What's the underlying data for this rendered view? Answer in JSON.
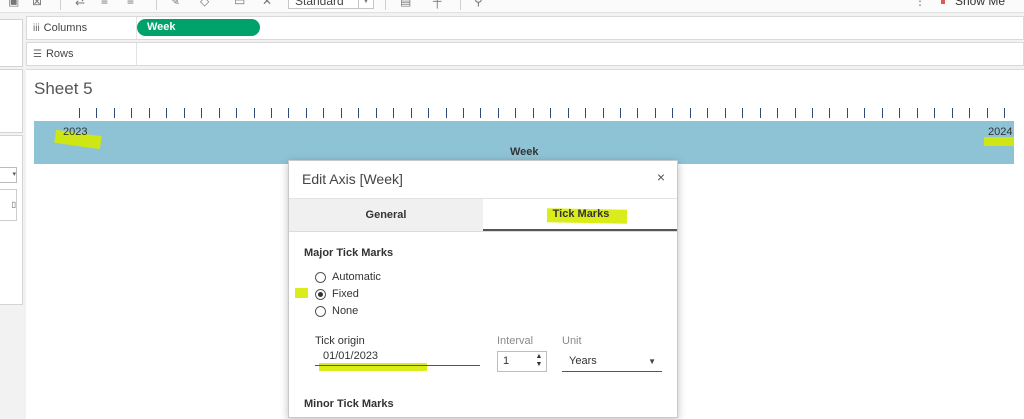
{
  "toolbar": {
    "zoom_select": "Standard",
    "show_me_label": "Show Me",
    "icons": [
      "clear-sheet-icon",
      "swap-icon",
      "sort-asc-icon",
      "sort-desc-icon",
      "highlight-icon",
      "group-icon",
      "label-icon",
      "pin-icon",
      "presentation-icon",
      "fix-axes-icon",
      "share-icon"
    ]
  },
  "shelves": {
    "columns_label": "Columns",
    "rows_label": "Rows",
    "columns_pill": "Week"
  },
  "sheet": {
    "title": "Sheet 5",
    "axis_start_label": "2023",
    "axis_end_label": "2024",
    "axis_title": "Week"
  },
  "dialog": {
    "title": "Edit Axis [Week]",
    "close_glyph": "×",
    "tabs": [
      {
        "label": "General",
        "active": false
      },
      {
        "label": "Tick Marks",
        "active": true
      }
    ],
    "major_heading": "Major Tick Marks",
    "options": [
      {
        "label": "Automatic",
        "selected": false
      },
      {
        "label": "Fixed",
        "selected": true
      },
      {
        "label": "None",
        "selected": false
      }
    ],
    "tick_origin_label": "Tick origin",
    "tick_origin_value": "01/01/2023",
    "interval_label": "Interval",
    "interval_value": "1",
    "unit_label": "Unit",
    "unit_value": "Years",
    "minor_heading": "Minor Tick Marks"
  },
  "colors": {
    "pill_green": "#00a26b",
    "axis_band": "#8ec3d6",
    "highlighter": "#d6ea00",
    "tick_color": "#2c4a7a"
  }
}
